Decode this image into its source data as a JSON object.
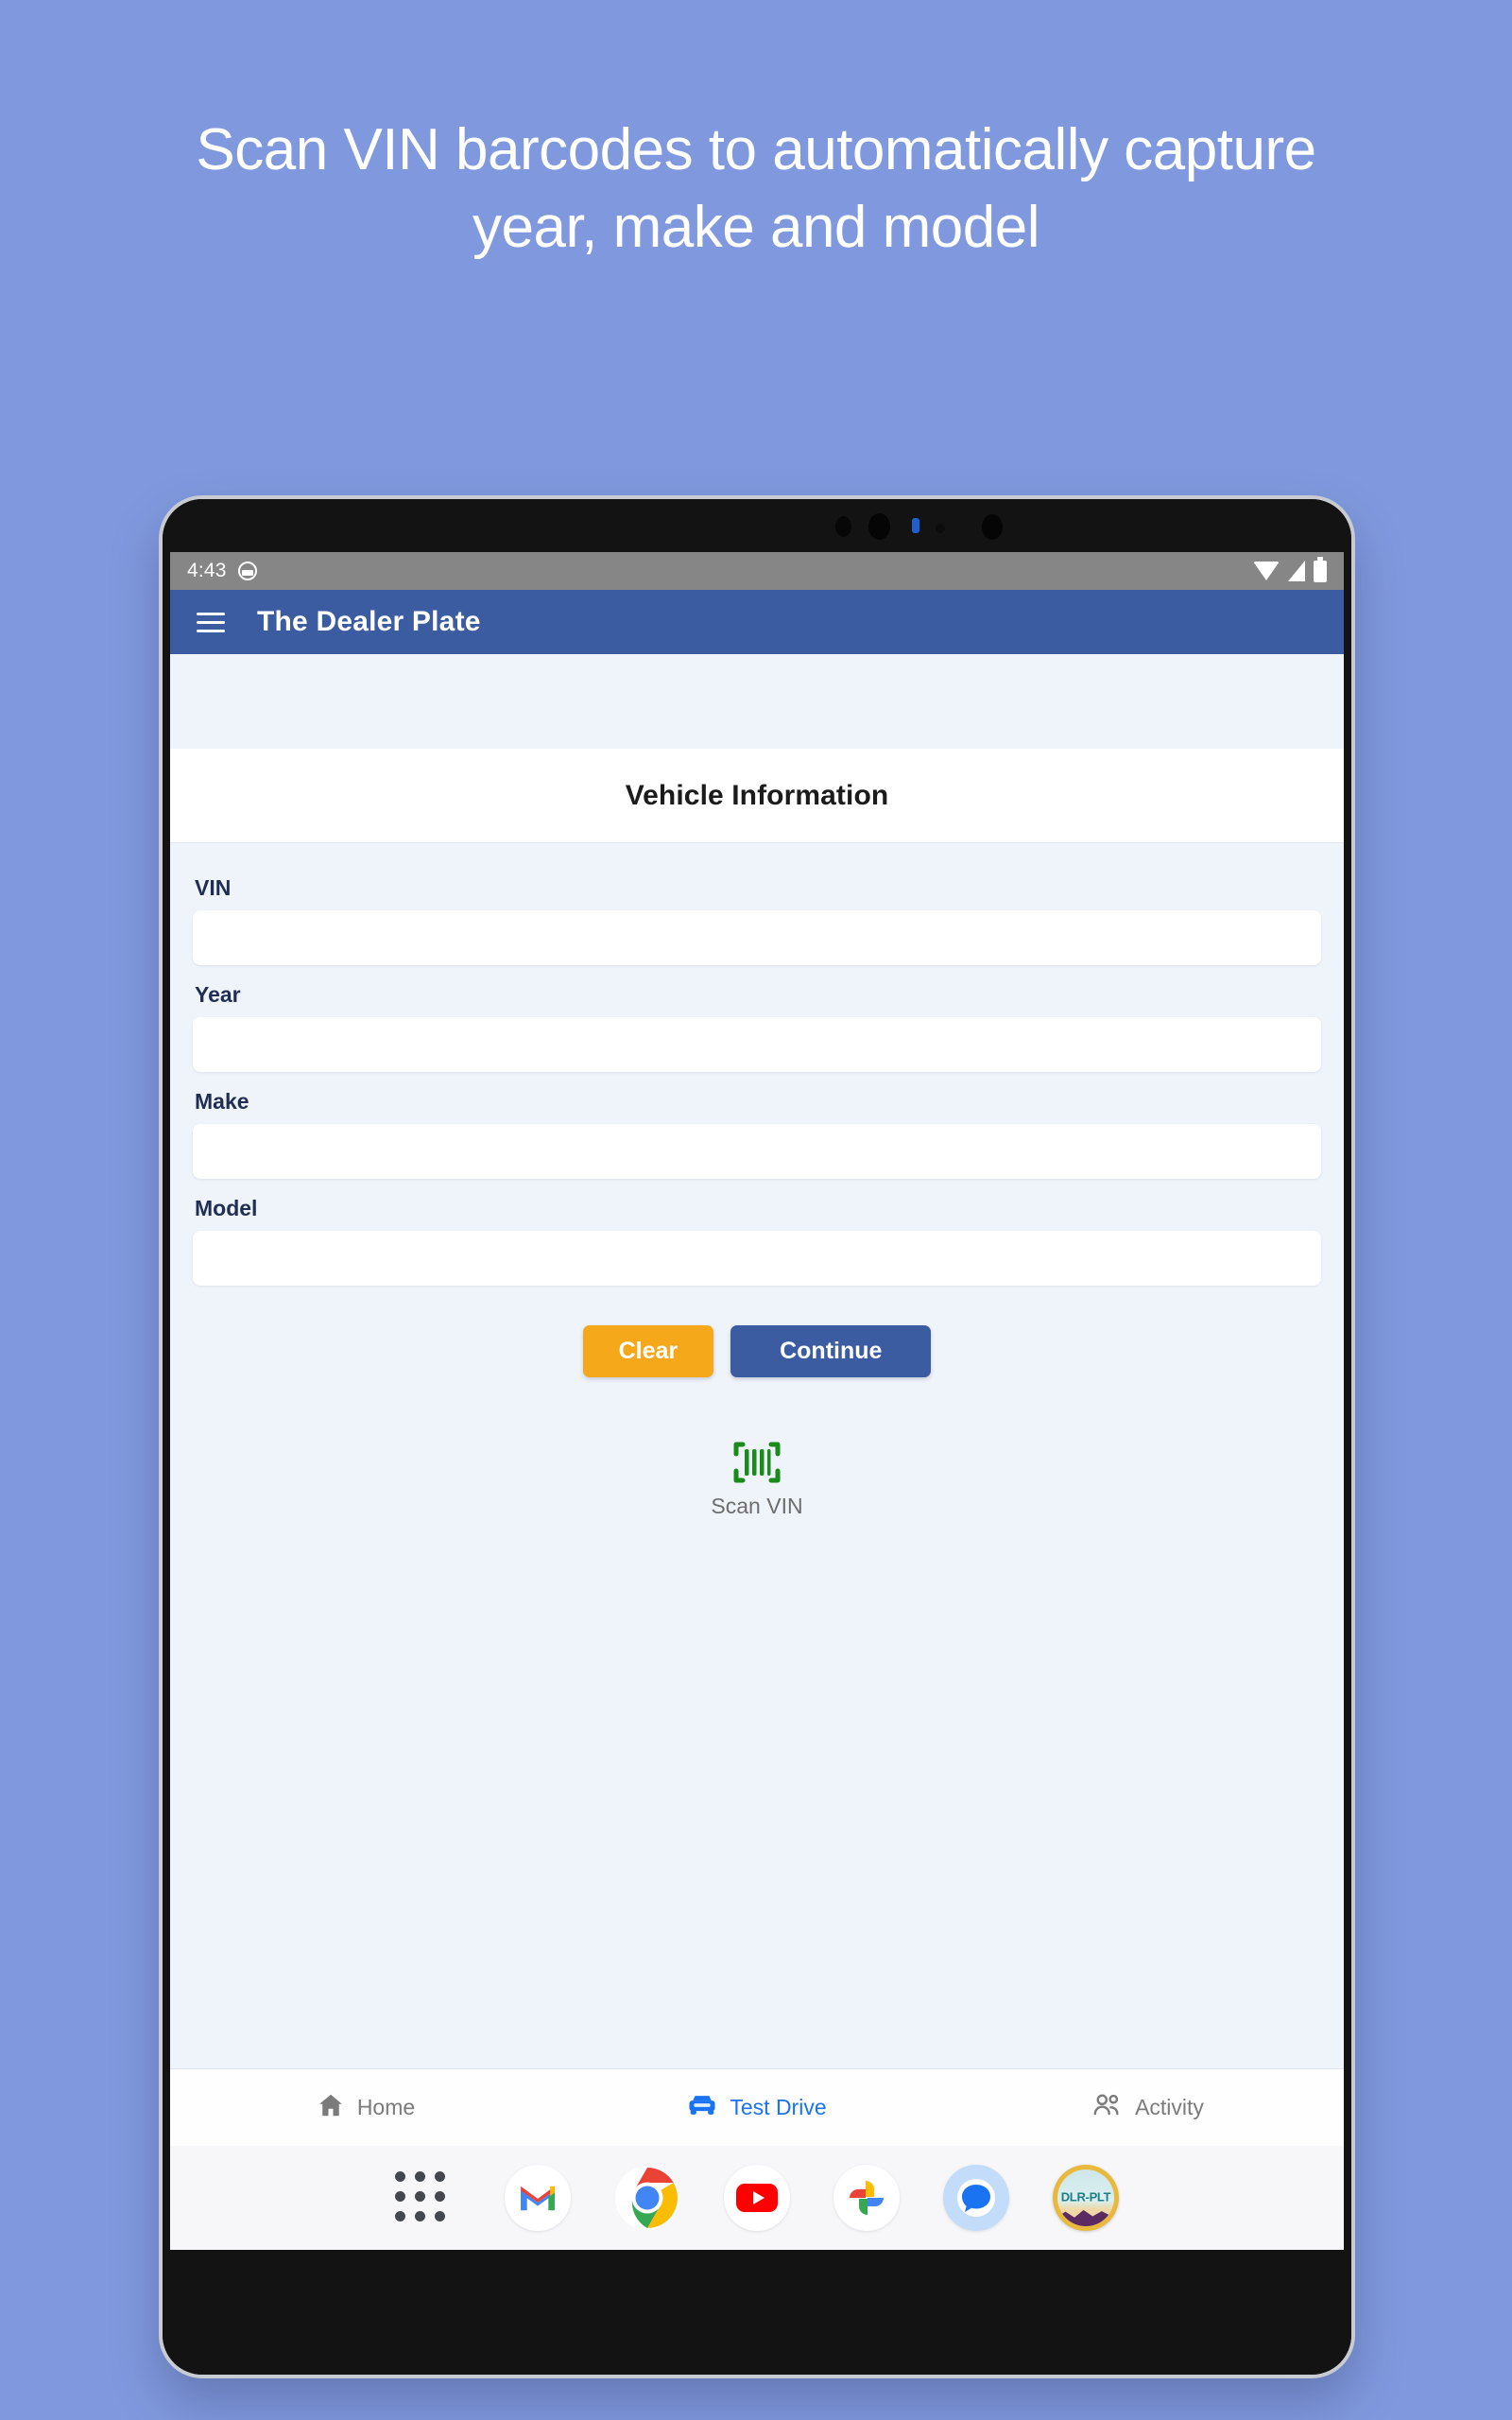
{
  "promo": {
    "headline_line1": "Scan VIN barcodes to automatically capture",
    "headline_line2": "year, make and model",
    "background_color": "#8099de",
    "text_color": "#ffffff"
  },
  "status_bar": {
    "time": "4:43",
    "badge_icon": "notification-badge-icon",
    "wifi_icon": "wifi-icon",
    "signal_icon": "cell-signal-icon",
    "battery_icon": "battery-icon",
    "background_color": "#868686"
  },
  "app_bar": {
    "menu_icon": "hamburger-menu-icon",
    "title": "The Dealer Plate",
    "background_color": "#3b5ca0"
  },
  "page": {
    "title": "Vehicle Information",
    "background_color": "#eff3fa"
  },
  "form": {
    "fields": [
      {
        "label": "VIN",
        "value": "",
        "placeholder": ""
      },
      {
        "label": "Year",
        "value": "",
        "placeholder": ""
      },
      {
        "label": "Make",
        "value": "",
        "placeholder": ""
      },
      {
        "label": "Model",
        "value": "",
        "placeholder": ""
      }
    ],
    "label_color": "#1f2e52"
  },
  "actions": {
    "clear_label": "Clear",
    "clear_color": "#f6a81b",
    "continue_label": "Continue",
    "continue_color": "#3b5ca0"
  },
  "scan": {
    "icon": "barcode-scan-icon",
    "label": "Scan VIN",
    "icon_color": "#1a8a1a",
    "label_color": "#6d6d6d"
  },
  "bottom_nav": {
    "items": [
      {
        "label": "Home",
        "icon": "home-icon",
        "active": false
      },
      {
        "label": "Test Drive",
        "icon": "car-icon",
        "active": true
      },
      {
        "label": "Activity",
        "icon": "people-icon",
        "active": false
      }
    ],
    "active_color": "#1a73f0",
    "inactive_color": "#7b7b7b"
  },
  "dock": {
    "apps": [
      {
        "name": "app-drawer",
        "label": ""
      },
      {
        "name": "gmail",
        "label": ""
      },
      {
        "name": "chrome",
        "label": ""
      },
      {
        "name": "youtube",
        "label": ""
      },
      {
        "name": "google-photos",
        "label": ""
      },
      {
        "name": "messages",
        "label": ""
      },
      {
        "name": "dealer-plate",
        "label": "DLR-PLT"
      }
    ]
  }
}
